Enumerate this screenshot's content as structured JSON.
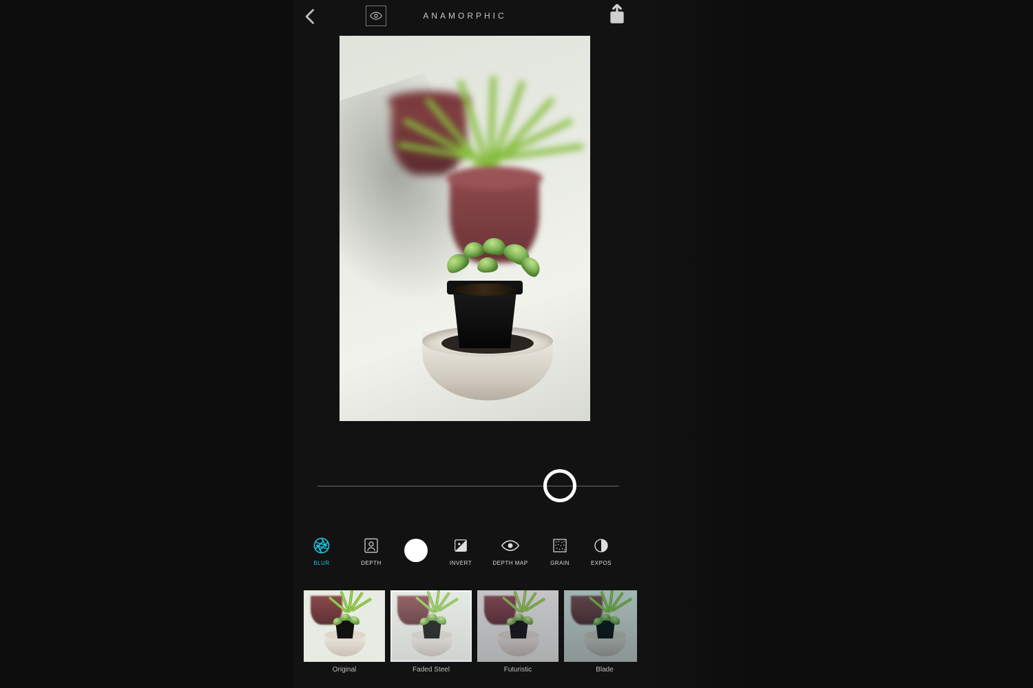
{
  "header": {
    "title": "ANAMORPHIC"
  },
  "slider": {
    "value_percent": 84
  },
  "tools": {
    "active": "blur",
    "items": [
      {
        "key": "blur",
        "label": "BLUR",
        "icon": "aperture-icon"
      },
      {
        "key": "depth",
        "label": "DEPTH",
        "icon": "portrait-icon"
      },
      {
        "key": "invert",
        "label": "INVERT",
        "icon": "invert-icon"
      },
      {
        "key": "depthmap",
        "label": "DEPTH MAP",
        "icon": "eye-icon"
      },
      {
        "key": "grain",
        "label": "GRAIN",
        "icon": "grain-icon"
      },
      {
        "key": "exposure",
        "label": "EXPOS",
        "icon": "exposure-icon"
      }
    ]
  },
  "filters": {
    "selected": "faded_steel",
    "items": [
      {
        "key": "original",
        "label": "Original"
      },
      {
        "key": "faded_steel",
        "label": "Faded Steel"
      },
      {
        "key": "futuristic",
        "label": "Futuristic"
      },
      {
        "key": "blade",
        "label": "Blade"
      }
    ]
  }
}
